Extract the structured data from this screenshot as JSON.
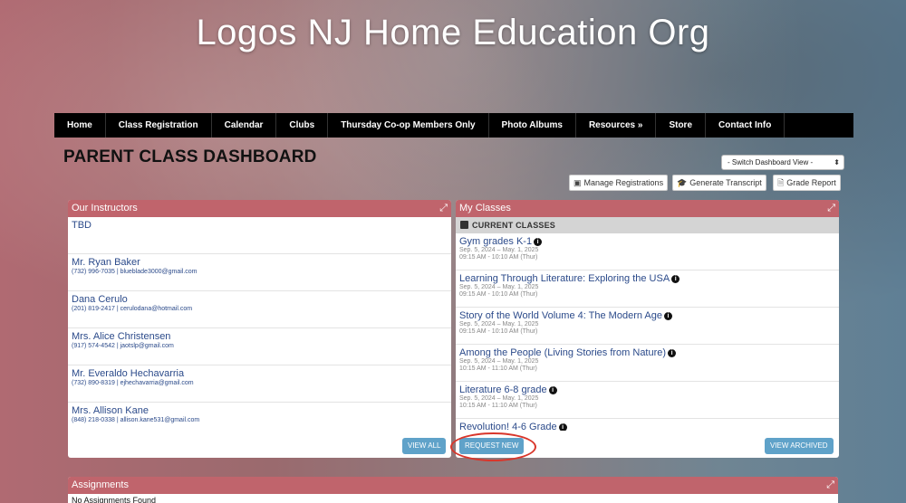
{
  "site": {
    "title": "Logos NJ Home Education Org"
  },
  "nav": [
    {
      "label": "Home"
    },
    {
      "label": "Class Registration"
    },
    {
      "label": "Calendar"
    },
    {
      "label": "Clubs"
    },
    {
      "label": "Thursday Co-op Members Only"
    },
    {
      "label": "Photo Albums"
    },
    {
      "label": "Resources »"
    },
    {
      "label": "Store"
    },
    {
      "label": "Contact Info"
    }
  ],
  "page": {
    "title": "PARENT CLASS DASHBOARD"
  },
  "dashboard_view": {
    "selected": "- Switch Dashboard View -"
  },
  "actions": {
    "manage": "Manage Registrations",
    "transcript": "Generate Transcript",
    "grade": "Grade Report"
  },
  "instructors_panel": {
    "title": "Our Instructors",
    "view_all": "VIEW ALL",
    "items": [
      {
        "name": "TBD",
        "contact": ""
      },
      {
        "name": "Mr. Ryan Baker",
        "contact": "(732) 996-7035 | blueblade3000@gmail.com"
      },
      {
        "name": "Dana Cerulo",
        "contact": "(201) 819-2417 | cerulodana@hotmail.com"
      },
      {
        "name": "Mrs. Alice Christensen",
        "contact": "(917) 574-4542 | jaotslp@gmail.com"
      },
      {
        "name": "Mr. Everaldo Hechavarria",
        "contact": "(732) 890-8319 | ejhechavarria@gmail.com"
      },
      {
        "name": "Mrs. Allison Kane",
        "contact": "(848) 218-0338 | allison.kane531@gmail.com"
      }
    ]
  },
  "classes_panel": {
    "title": "My Classes",
    "section": "CURRENT CLASSES",
    "request_new": "REQUEST NEW",
    "view_archived": "VIEW ARCHIVED",
    "items": [
      {
        "name": "Gym grades K-1",
        "dates": "Sep. 5, 2024 – May. 1, 2025",
        "time": "09:15 AM - 10:10 AM (Thur)"
      },
      {
        "name": "Learning Through Literature: Exploring the USA",
        "dates": "Sep. 5, 2024 – May. 1, 2025",
        "time": "09:15 AM - 10:10 AM (Thur)"
      },
      {
        "name": "Story of the World Volume 4: The Modern Age",
        "dates": "Sep. 5, 2024 – May. 1, 2025",
        "time": "09:15 AM - 10:10 AM (Thur)"
      },
      {
        "name": "Among the People (Living Stories from Nature)",
        "dates": "Sep. 5, 2024 – May. 1, 2025",
        "time": "10:15 AM - 11:10 AM (Thur)"
      },
      {
        "name": "Literature 6-8 grade",
        "dates": "Sep. 5, 2024 – May. 1, 2025",
        "time": "10:15 AM - 11:10 AM (Thur)"
      },
      {
        "name": "Revolution! 4-6 Grade",
        "dates": "",
        "time": ""
      }
    ]
  },
  "assignments_panel": {
    "title": "Assignments",
    "empty": "No Assignments Found"
  },
  "colors": {
    "panel_header": "#c0646c",
    "button_blue": "#5fa2c9",
    "link": "#2b4a8a",
    "highlight_circle": "#d9362b"
  },
  "icons": {
    "manage": "calendar-check-icon",
    "transcript": "graduation-cap-icon",
    "grade": "document-icon",
    "expand": "expand-icon",
    "info": "info-icon"
  }
}
